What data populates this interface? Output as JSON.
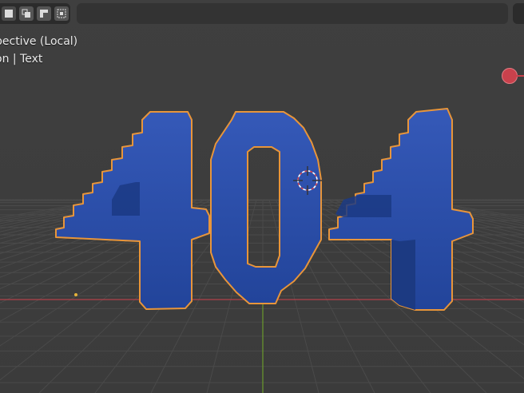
{
  "viewport": {
    "title": "pective (Local)",
    "subtitle": "on | Text",
    "object_text": "404"
  },
  "toolbar": {
    "icons": [
      "select-box-icon",
      "select-extend-icon",
      "select-subtract-icon",
      "select-intersect-icon"
    ]
  },
  "colors": {
    "background": "#3d3d3d",
    "grid": "#4a4a4a",
    "x_axis": "#b3414a",
    "y_axis": "#6a9a2c",
    "object_fill": "#2b4ea8",
    "selection_outline": "#e8953a",
    "gizmo_x": "#c9414c",
    "cursor_red": "#d6454f"
  }
}
